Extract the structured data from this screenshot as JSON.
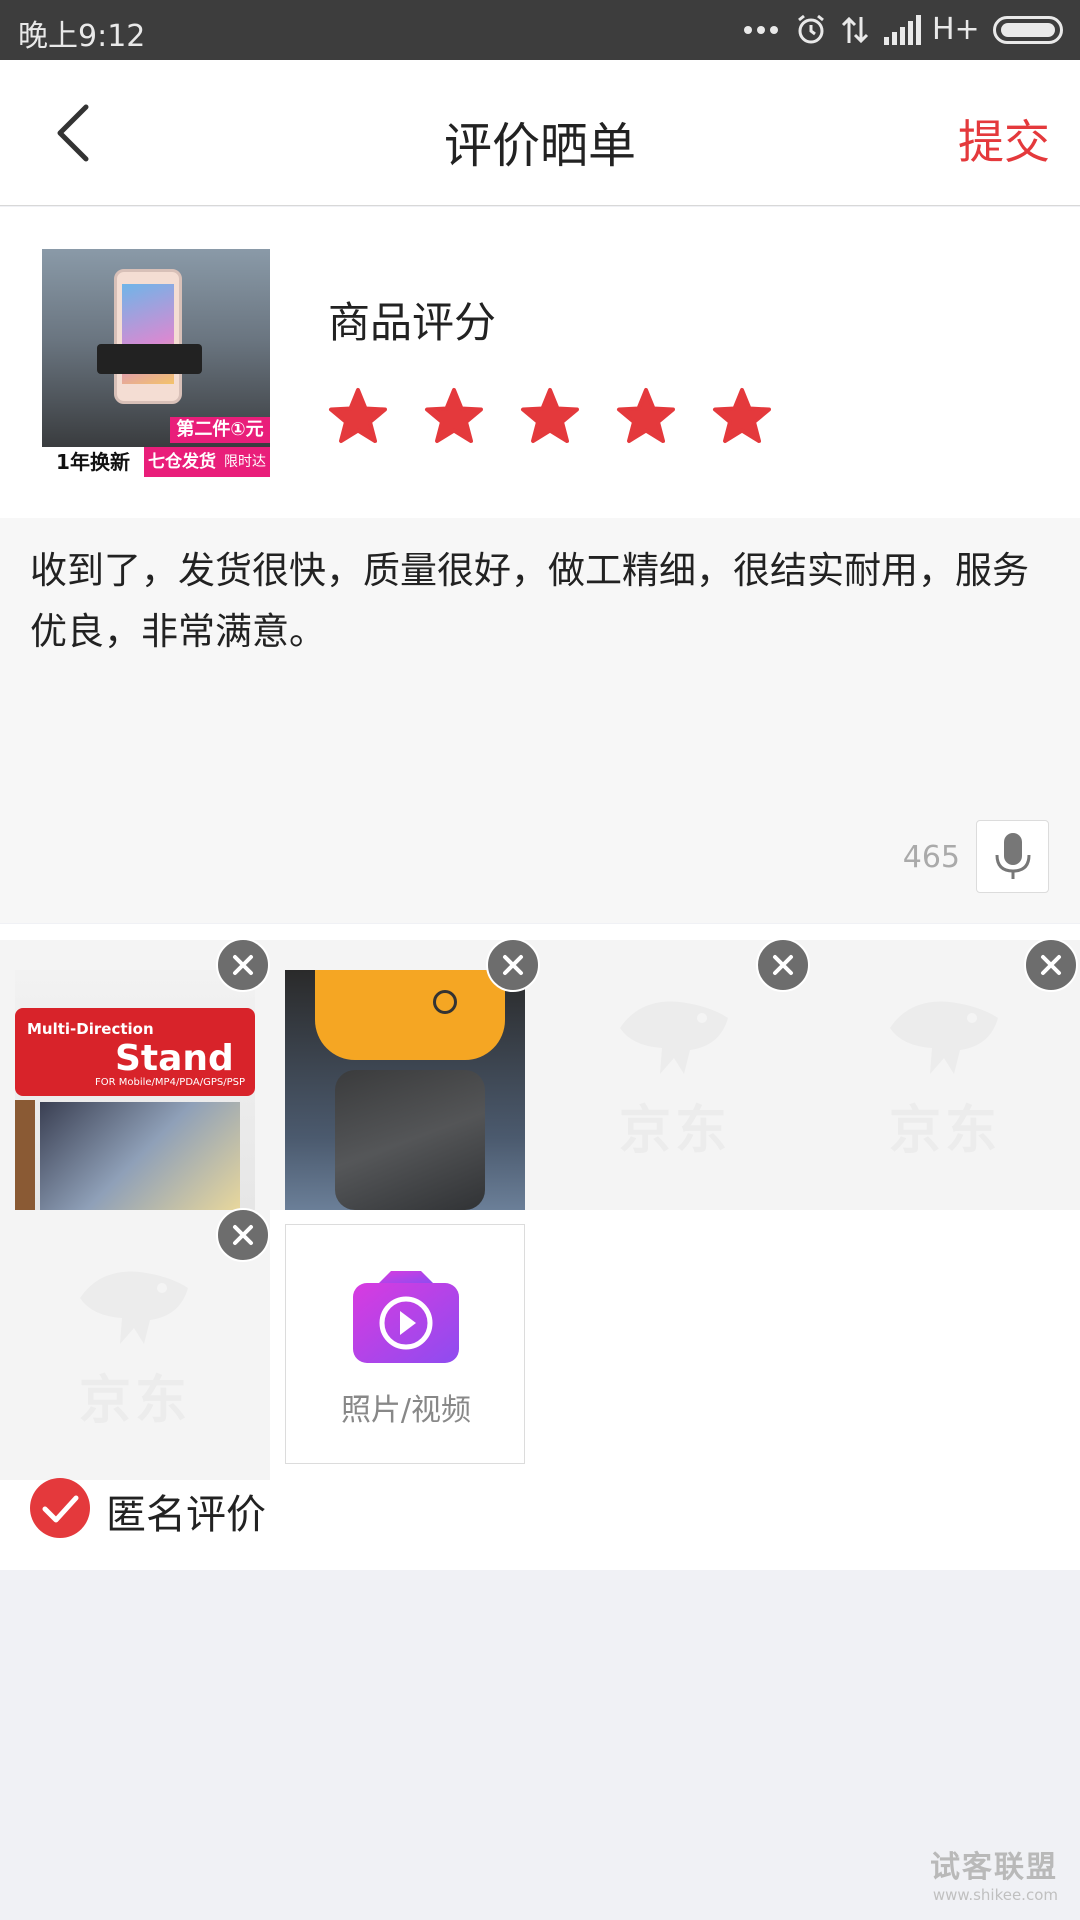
{
  "status_bar": {
    "time": "晚上9:12",
    "network": "H+",
    "icons": [
      "more-dots-icon",
      "alarm-icon",
      "data-transfer-icon",
      "signal-icon",
      "battery-icon"
    ]
  },
  "header": {
    "title": "评价晒单",
    "submit_label": "提交",
    "back_icon": "chevron-left-icon"
  },
  "product": {
    "thumbnail_badges": {
      "second_item": "第二件①元",
      "warranty": "1年换新",
      "warehouse": "七仓发货",
      "limited": "限时达"
    },
    "rating_label": "商品评分",
    "rating": 5,
    "rating_max": 5
  },
  "review": {
    "text": "收到了，发货很快，质量很好，做工精细，很结实耐用，服务优良，非常满意。",
    "char_count": "465"
  },
  "photos": {
    "stand_photo": {
      "line1": "Multi-Direction",
      "line2": "Stand",
      "line3": "FOR Mobile/MP4/PDA/GPS/PSP"
    },
    "placeholder_logo_text": "京东",
    "add_media_label": "照片/视频"
  },
  "anonymous": {
    "label": "匿名评价",
    "checked": true
  },
  "watermark": {
    "line1": "试客联盟",
    "line2": "www.shikee.com"
  },
  "colors": {
    "accent_red": "#e4393c",
    "status_bar": "#3d3d3d",
    "page_bg": "#f0f1f5"
  }
}
